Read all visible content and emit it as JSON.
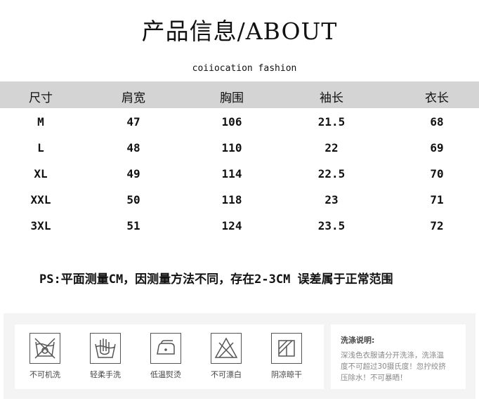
{
  "title": "产品信息/ABOUT",
  "brand": "coiiocation fashion",
  "table": {
    "headers": [
      "尺寸",
      "肩宽",
      "胸围",
      "袖长",
      "衣长"
    ],
    "rows": [
      [
        "M",
        "47",
        "106",
        "21.5",
        "68"
      ],
      [
        "L",
        "48",
        "110",
        "22",
        "69"
      ],
      [
        "XL",
        "49",
        "114",
        "22.5",
        "70"
      ],
      [
        "XXL",
        "50",
        "118",
        "23",
        "71"
      ],
      [
        "3XL",
        "51",
        "124",
        "23.5",
        "72"
      ]
    ]
  },
  "note": "PS:平面测量CM，因测量方法不同，存在2-3CM 误差属于正常范围",
  "care": {
    "icons": [
      {
        "icon": "no-machine-wash-icon",
        "label": "不可机洗"
      },
      {
        "icon": "hand-wash-icon",
        "label": "轻柔手洗"
      },
      {
        "icon": "iron-low-icon",
        "label": "低温熨烫"
      },
      {
        "icon": "no-bleach-icon",
        "label": "不可漂白"
      },
      {
        "icon": "shade-dry-icon",
        "label": "阴凉晾干"
      }
    ],
    "instructions_title": "洗涤说明:",
    "instructions_lines": [
      "深浅色衣服请分开洗涤，洗涤温",
      "度不可超过30摄氏度！忽拧绞挤",
      "压除水！不可暴晒！"
    ]
  }
}
